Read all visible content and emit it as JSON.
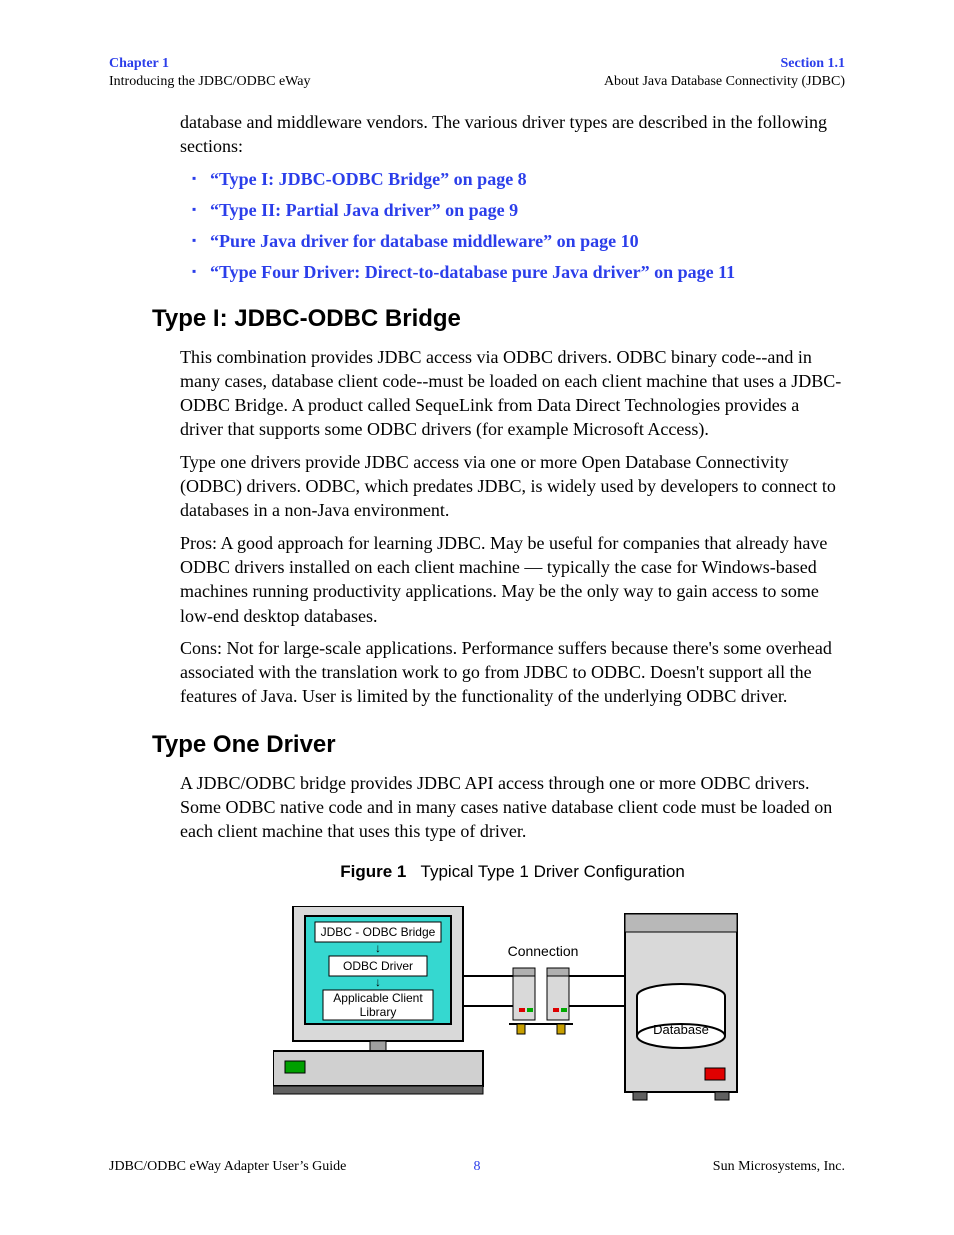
{
  "header": {
    "left_top": "Chapter 1",
    "left_sub": "Introducing the JDBC/ODBC eWay",
    "right_top": "Section 1.1",
    "right_sub": "About Java Database Connectivity (JDBC)"
  },
  "intro": "database and middleware vendors. The various driver types are described in the following sections:",
  "links": [
    "“Type I: JDBC-ODBC Bridge” on page 8",
    "“Type II: Partial Java driver” on page 9",
    "“Pure Java driver for database middleware” on page 10",
    "“Type Four Driver: Direct-to-database pure Java driver” on page 11"
  ],
  "sec1": {
    "title": "Type I: JDBC-ODBC Bridge",
    "p1": "This combination provides JDBC access via ODBC drivers. ODBC binary code--and in many cases, database client code--must be loaded on each client machine that uses a JDBC-ODBC Bridge. A product called SequeLink from Data Direct Technologies provides a driver that supports some ODBC drivers (for example Microsoft Access).",
    "p2": "Type one drivers provide JDBC access via one or more Open Database Connectivity (ODBC) drivers. ODBC, which predates JDBC, is widely used by developers to connect to databases in a non-Java environment.",
    "p3": "Pros: A good approach for learning JDBC. May be useful for companies that already have ODBC drivers installed on each client machine — typically the case for Windows-based machines running productivity applications. May be the only way to gain access to some low-end desktop databases.",
    "p4": "Cons: Not for large-scale applications. Performance suffers because there's some overhead associated with the translation work to go from JDBC to ODBC. Doesn't support all the features of Java. User is limited by the functionality of the underlying ODBC driver."
  },
  "sec2": {
    "title": "Type One Driver",
    "p1": "A JDBC/ODBC bridge provides JDBC API access through one or more ODBC drivers. Some ODBC native code and in many cases native database client code must be loaded on each client machine that uses this type of driver."
  },
  "figure": {
    "label": "Figure 1",
    "caption": "Typical Type 1 Driver Configuration",
    "box1": "JDBC - ODBC Bridge",
    "box2": "ODBC Driver",
    "box3a": "Applicable Client",
    "box3b": "Library",
    "conn": "Connection",
    "db": "Database"
  },
  "footer": {
    "left": "JDBC/ODBC eWay Adapter User’s Guide",
    "center": "8",
    "right": "Sun Microsystems, Inc."
  }
}
